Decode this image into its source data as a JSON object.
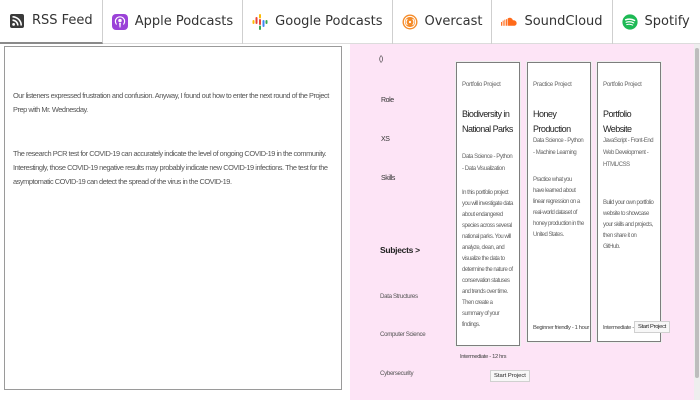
{
  "tabs": [
    {
      "label": "RSS Feed",
      "icon": "rss-icon",
      "active": true
    },
    {
      "label": "Apple Podcasts",
      "icon": "apple-podcasts-icon",
      "active": false
    },
    {
      "label": "Google Podcasts",
      "icon": "google-podcasts-icon",
      "active": false
    },
    {
      "label": "Overcast",
      "icon": "overcast-icon",
      "active": false
    },
    {
      "label": "SoundCloud",
      "icon": "soundcloud-icon",
      "active": false
    },
    {
      "label": "Spotify",
      "icon": "spotify-icon",
      "active": false
    }
  ],
  "colors": {
    "rss": "#333333",
    "apple": "#9b42d8",
    "google": "#4285f4",
    "overcast": "#f58c2a",
    "soundcloud": "#ff6a1a",
    "spotify": "#1db954",
    "panel_pink": "#fde4f6"
  },
  "transcript": {
    "paragraph_1": "Our listeners expressed frustration and confusion. Anyway, I found out how to enter the next round of the Project Prep with Mr. Wednesday.",
    "paragraph_2": "The research PCR test for COVID-19 can accurately indicate the level of ongoing COVID-19 in the community. Interestingly, those COVID-19 negative results may probably indicate new COVID-19 infections. The test for the asymptomatic COVID-19 can detect the spread of the virus in the COVID-19."
  },
  "filters": {
    "item_1": "()",
    "item_2": "Role",
    "item_3": "XS",
    "item_4": "Skills",
    "subjects_label": "Subjects >",
    "subject_1": "Data Structures",
    "subject_2": "Computer Science",
    "subject_3": "Cybersecurity"
  },
  "cards": [
    {
      "type": "Portfolio Project",
      "title": "Biodiversity in National Parks",
      "meta": "Data Science - Python - Data Visualization",
      "desc": "In this portfolio project you will investigate data about endangered species across several national parks. You will analyze, clean, and visualize the data to determine the nature of conservation statuses and trends over time. Then create a summary of your findings.",
      "foot": "Intermediate - 12 hrs",
      "button": "Start Project"
    },
    {
      "type": "Practice Project",
      "title": "Honey Production",
      "meta": "Data Science - Python - Machine Learning",
      "desc": "Practice what you have learned about linear regression on a real-world dataset of honey production in the United States.",
      "foot": "Beginner friendly - 1 hour",
      "button": ""
    },
    {
      "type": "Portfolio Project",
      "title": "Portfolio Website",
      "meta": "JavaScript - Front-End Web Development - HTML/CSS",
      "desc": "Build your own portfolio website to showcase your skills and projects, then share it on GitHub.",
      "foot": "Intermediate - 3 hrs",
      "button": "Start Project"
    }
  ]
}
